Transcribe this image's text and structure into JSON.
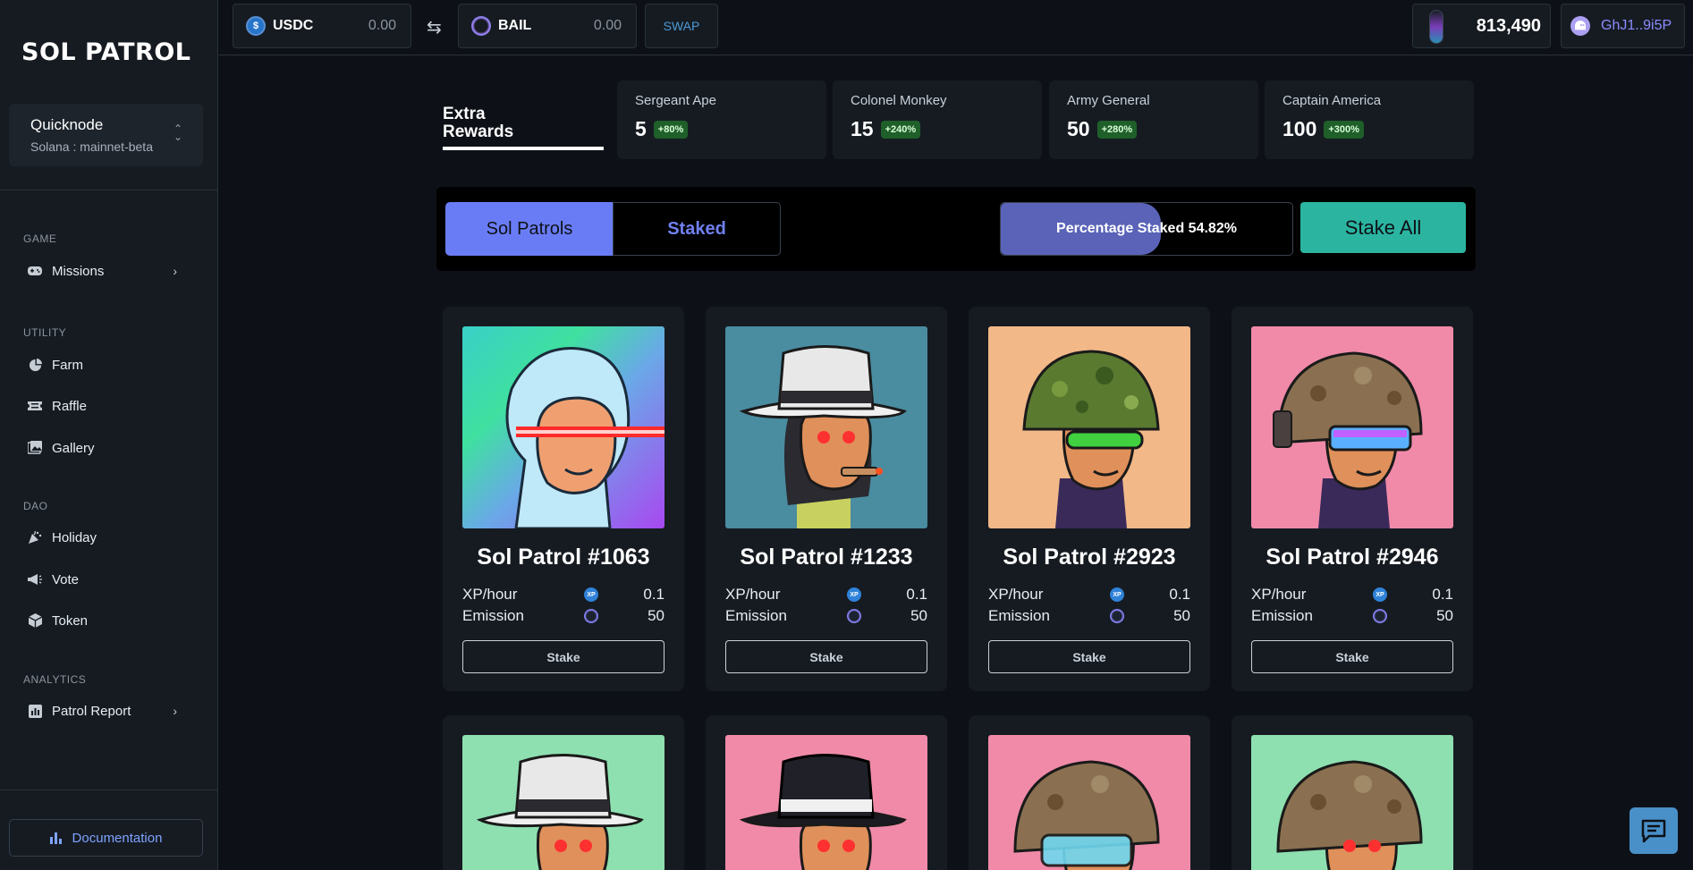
{
  "sidebar": {
    "logo": "SOL PATROL",
    "network": {
      "name": "Quicknode",
      "sub": "Solana : mainnet-beta"
    },
    "sections": {
      "game": "GAME",
      "utility": "UTILITY",
      "dao": "DAO",
      "analytics": "ANALYTICS"
    },
    "items": {
      "missions": "Missions",
      "farm": "Farm",
      "raffle": "Raffle",
      "gallery": "Gallery",
      "holiday": "Holiday",
      "vote": "Vote",
      "token": "Token",
      "patrol_report": "Patrol Report"
    },
    "documentation": "Documentation"
  },
  "topbar": {
    "usdc": {
      "symbol": "USDC",
      "value": "0.00"
    },
    "bail": {
      "symbol": "BAIL",
      "value": "0.00"
    },
    "swap": "SWAP",
    "balance": "813,490",
    "wallet": "GhJ1..9i5P"
  },
  "rewards": {
    "title_line1": "Extra",
    "title_line2": "Rewards",
    "tiers": [
      {
        "name": "Sergeant Ape",
        "count": "5",
        "bonus": "+80%"
      },
      {
        "name": "Colonel Monkey",
        "count": "15",
        "bonus": "+240%"
      },
      {
        "name": "Army General",
        "count": "50",
        "bonus": "+280%"
      },
      {
        "name": "Captain America",
        "count": "100",
        "bonus": "+300%"
      }
    ]
  },
  "tabs": {
    "sol_patrols": "Sol Patrols",
    "staked": "Staked",
    "percentage_label": "Percentage Staked 54.82%",
    "percentage_value": 54.82,
    "stake_all": "Stake All"
  },
  "cards": [
    {
      "title": "Sol Patrol #1063",
      "xp_label": "XP/hour",
      "xp": "0.1",
      "em_label": "Emission",
      "emission": "50",
      "button": "Stake"
    },
    {
      "title": "Sol Patrol #1233",
      "xp_label": "XP/hour",
      "xp": "0.1",
      "em_label": "Emission",
      "emission": "50",
      "button": "Stake"
    },
    {
      "title": "Sol Patrol #2923",
      "xp_label": "XP/hour",
      "xp": "0.1",
      "em_label": "Emission",
      "emission": "50",
      "button": "Stake"
    },
    {
      "title": "Sol Patrol #2946",
      "xp_label": "XP/hour",
      "xp": "0.1",
      "em_label": "Emission",
      "emission": "50",
      "button": "Stake"
    }
  ],
  "colors": {
    "accent": "#6a7cf5",
    "teal": "#2bb5a0",
    "background": "#0d1117",
    "panel": "#161b22"
  }
}
